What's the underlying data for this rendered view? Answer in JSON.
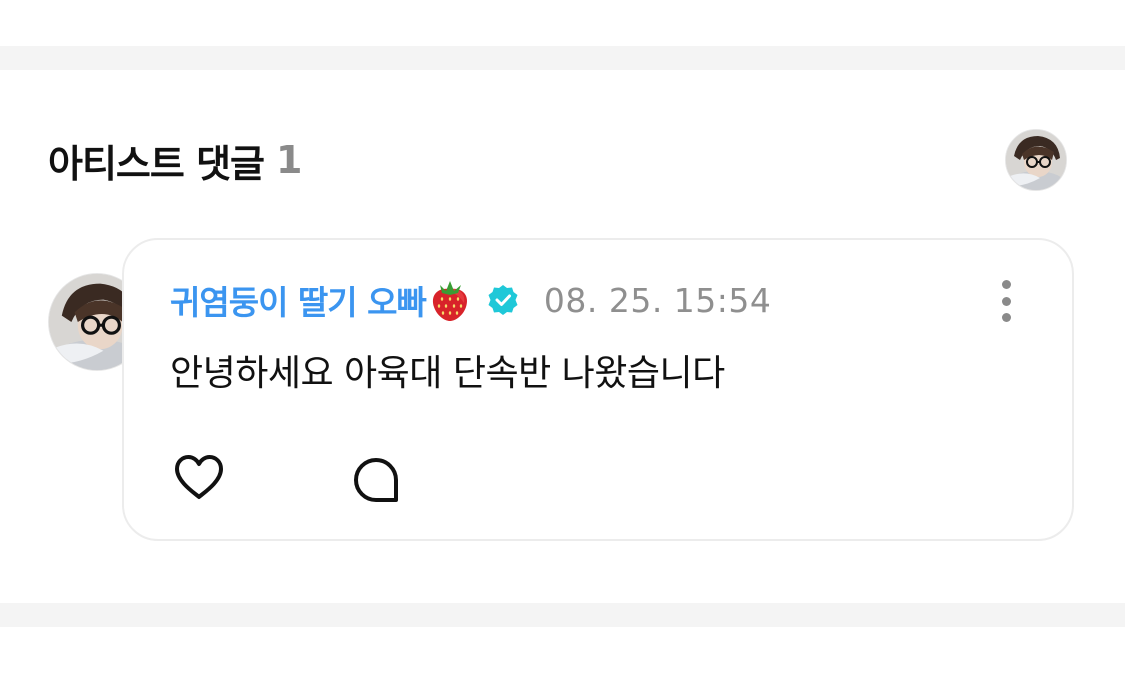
{
  "section": {
    "title": "아티스트 댓글",
    "count": "1"
  },
  "comment": {
    "author": "귀염둥이 딸기 오빠",
    "author_emoji": "strawberry-icon",
    "verified": true,
    "timestamp": "08. 25. 15:54",
    "text": "안녕하세요 아육대 단속반 나왔습니다",
    "actions": [
      "like-icon",
      "reply-icon",
      "more-options-icon"
    ]
  },
  "colors": {
    "author": "#3b95f0",
    "verified_badge": "#1fc8d8",
    "timestamp": "#8f8f8f",
    "count": "#8a8a8a",
    "divider": "#f4f4f4"
  }
}
